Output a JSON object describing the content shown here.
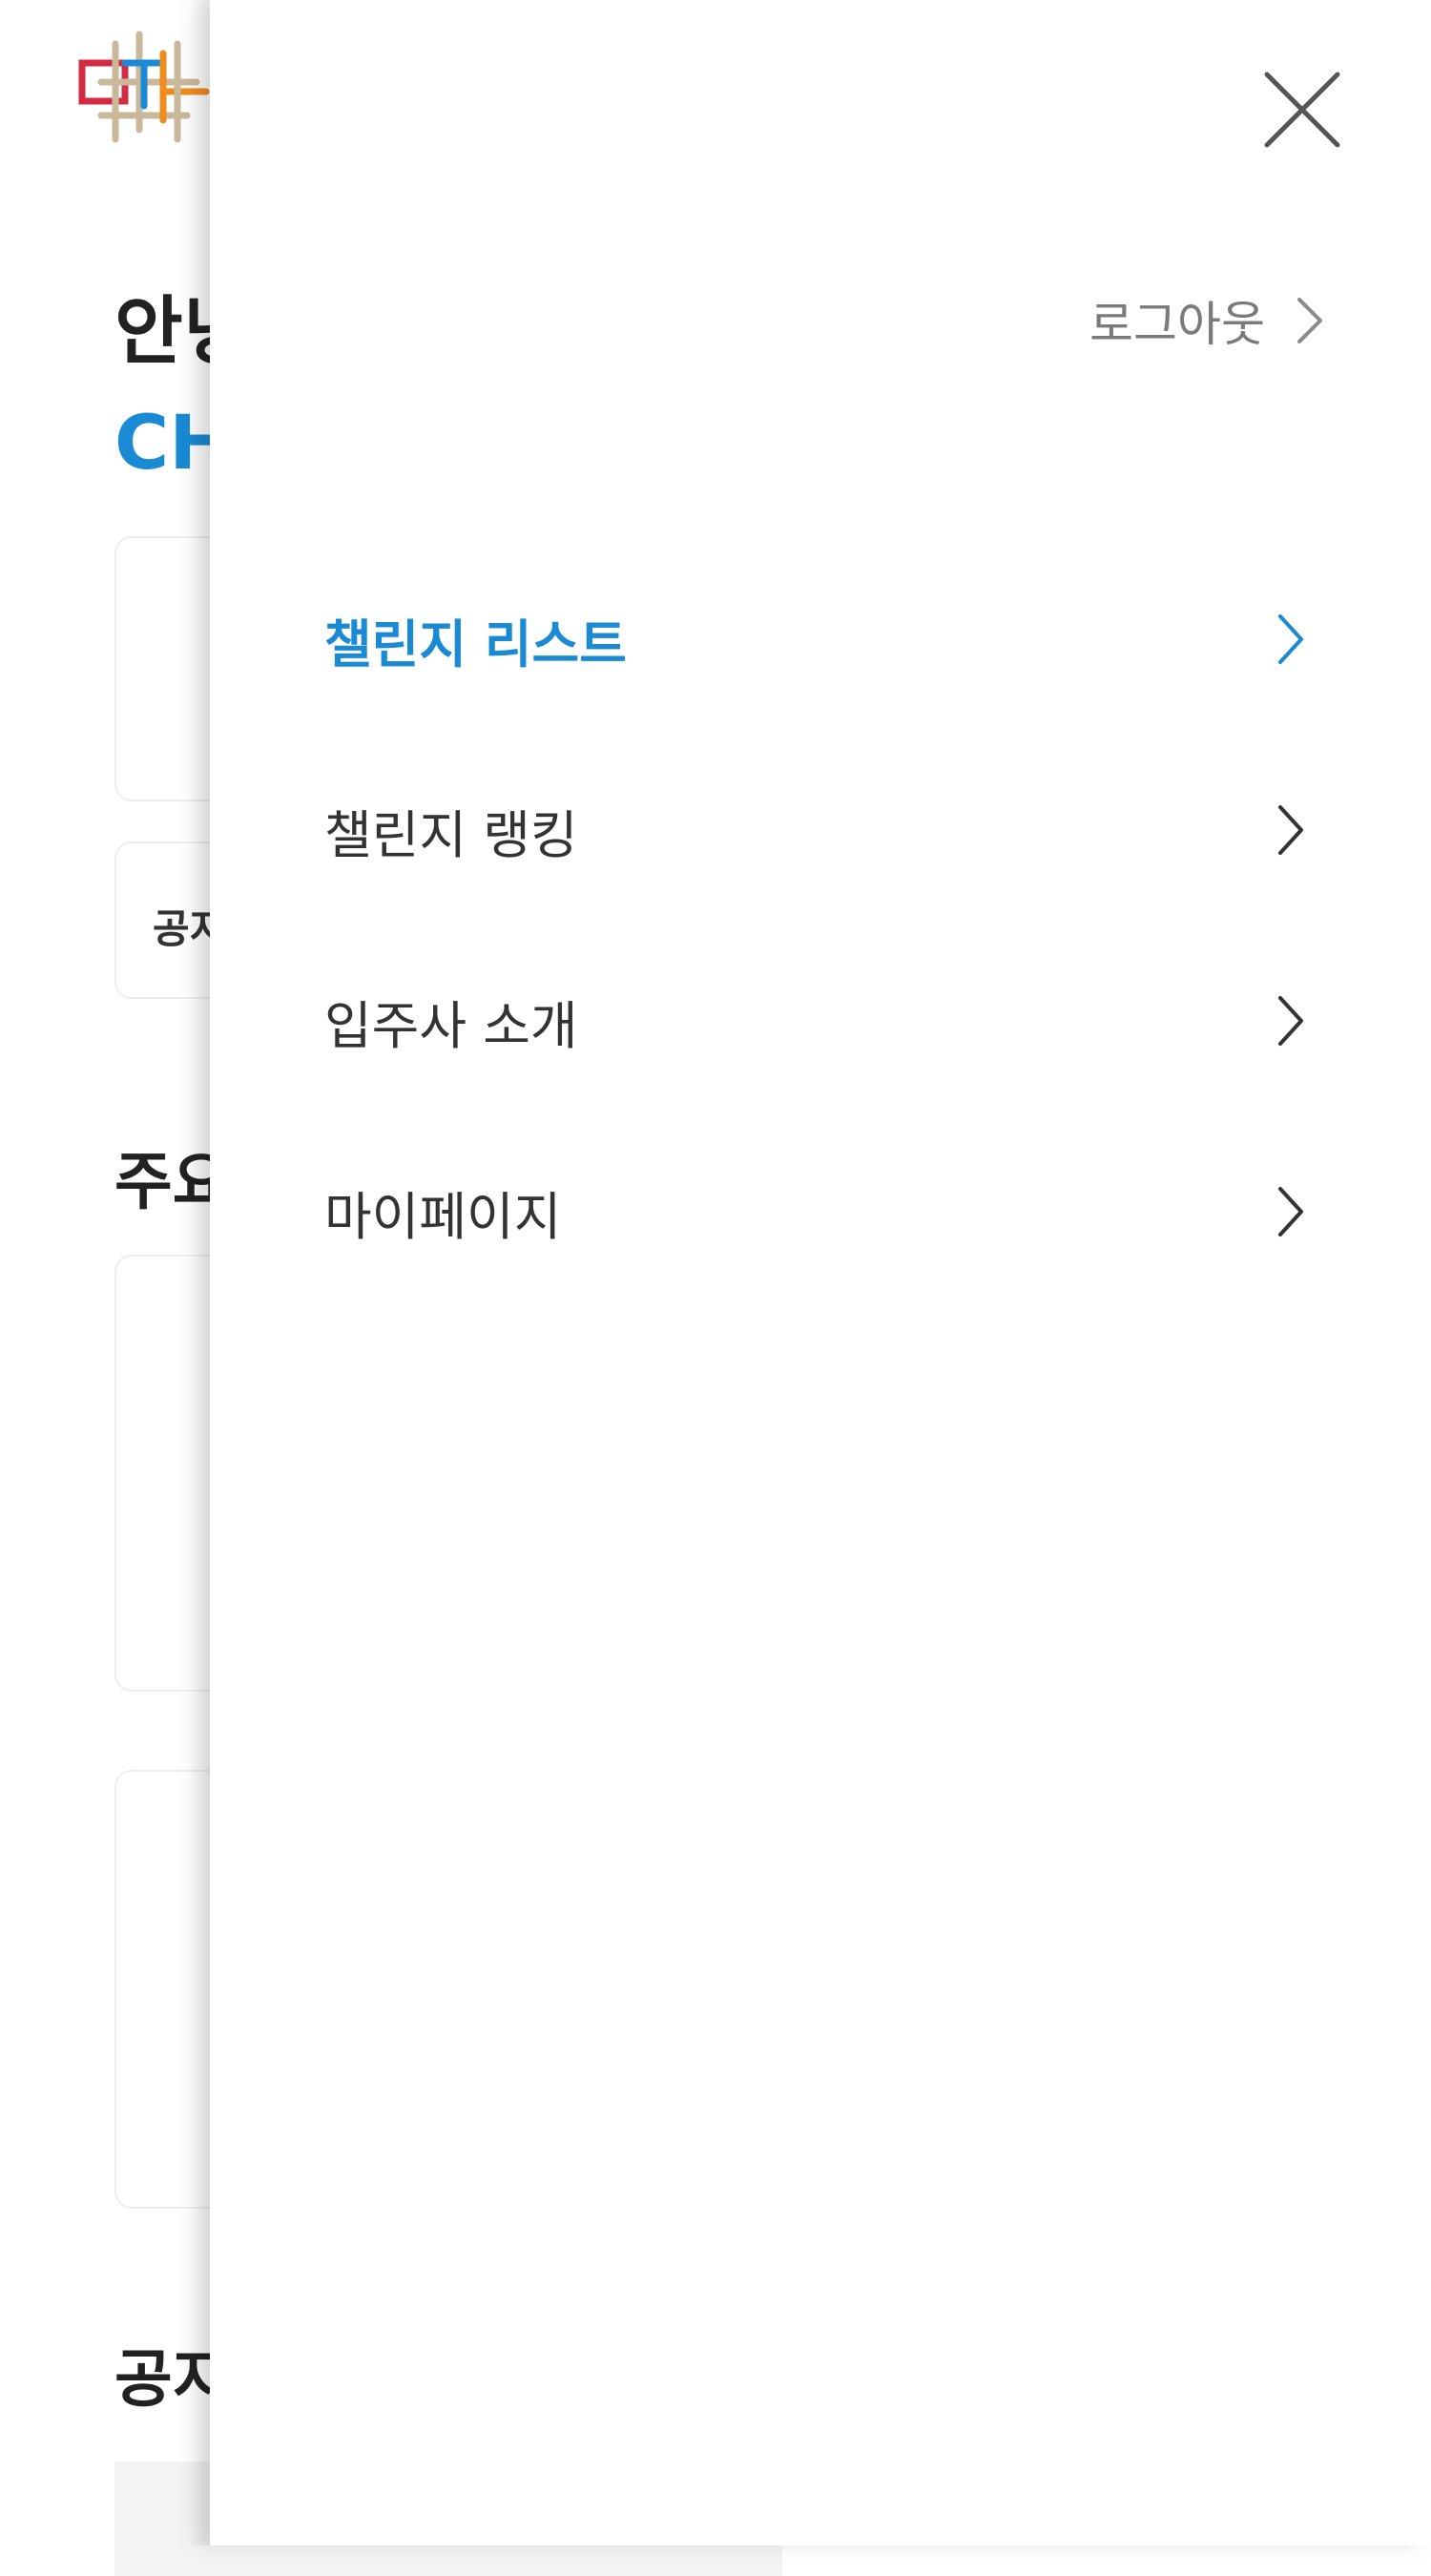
{
  "background_page": {
    "greeting_partial": "안녕",
    "name_partial": "CH",
    "notice_label_partial": "공지",
    "section_1_partial": "주요",
    "section_2_partial": "공지"
  },
  "drawer": {
    "logout_label": "로그아웃",
    "menu": [
      {
        "label": "챌린지 리스트",
        "active": true
      },
      {
        "label": "챌린지 랭킹",
        "active": false
      },
      {
        "label": "입주사 소개",
        "active": false
      },
      {
        "label": "마이페이지",
        "active": false
      }
    ]
  },
  "colors": {
    "accent": "#1a8ad4",
    "text_primary": "#333333",
    "text_secondary": "#7a7a7a"
  },
  "icons": {
    "close": "close-icon",
    "chevron": "chevron-right-icon",
    "logo": "brand-logo"
  }
}
